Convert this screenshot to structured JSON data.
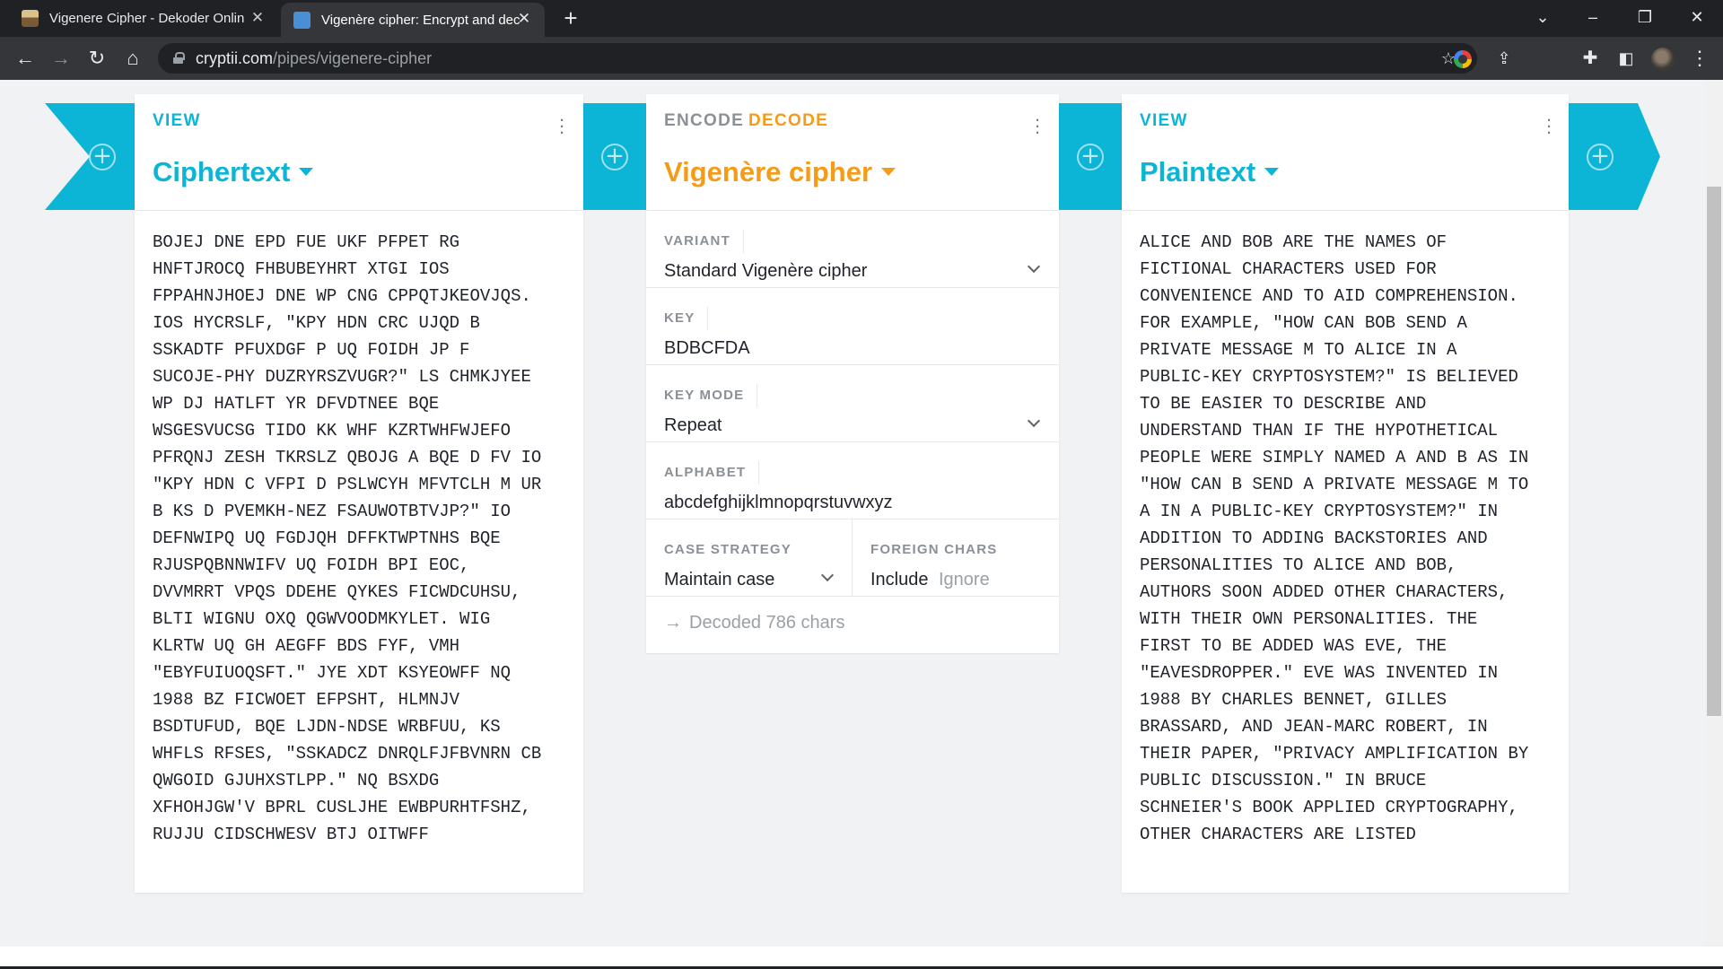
{
  "browser": {
    "tabs": [
      {
        "title": "Vigenere Cipher - Dekoder Onlin"
      },
      {
        "title": "Vigenère cipher: Encrypt and dec"
      }
    ],
    "url_host": "cryptii.com",
    "url_path": "/pipes/vigenere-cipher"
  },
  "colors": {
    "accent_teal": "#0cb5d6",
    "accent_orange": "#f49c17"
  },
  "pipeline": {
    "input": {
      "label": "VIEW",
      "title": "Ciphertext",
      "text": "BOJEJ DNE EPD FUE UKF PFPET RG\nHNFTJROCQ FHBUBEYHRT XTGI IOS\nFPPAHNJHOEJ DNE WP CNG CPPQTJKEOVJQS.\nIOS HYCRSLF, \"KPY HDN CRC UJQD B\nSSKADTF PFUXDGF P UQ FOIDH JP F\nSUCOJE-PHY DUZRYRSZVUGR?\" LS CHMKJYEE\nWP DJ HATLFT YR DFVDTNEE BQE\nWSGESVUCSG TIDO KK WHF KZRTWHFWJEFO\nPFRQNJ ZESH TKRSLZ QBOJG A BQE D FV IO\n\"KPY HDN C VFPI D PSLWCYH MFVTCLH M UR\nB KS D PVEMKH-NEZ FSAUWOTBTVJP?\" IO\nDEFNWIPQ UQ FGDJQH DFFKTWPTNHS BQE\nRJUSPQBNNWIFV UQ FOIDH BPI EOC,\nDVVMRRT VPQS DDEHE QYKES FICWDCUHSU,\nBLTI WIGNU OXQ QGWVOODMKYLET. WIG\nKLRTW UQ GH AEGFF BDS FYF, VMH\n\"EBYFUIUOQSFT.\" JYE XDT KSYEOWFF NQ\n1988 BZ FICWOET EFPSHT, HLMNJV\nBSDTUFUD, BQE LJDN-NDSE WRBFUU, KS\nWHFLS RFSES, \"SSKADCZ DNRQLFJFBVNRN CB\nQWGOID GJUHXSTLPP.\" NQ BSXDG\nXFHOHJGW'V BPRL CUSLJHE EWBPURHTFSHZ,\nRUJJU CIDSCHWESV BTJ OITWFF"
    },
    "encoder": {
      "modes": [
        "ENCODE",
        "DECODE"
      ],
      "active_mode": "DECODE",
      "title": "Vigenère cipher",
      "variant": {
        "label": "VARIANT",
        "value": "Standard Vigenère cipher"
      },
      "key": {
        "label": "KEY",
        "value": "BDBCFDA"
      },
      "key_mode": {
        "label": "KEY MODE",
        "value": "Repeat"
      },
      "alphabet": {
        "label": "ALPHABET",
        "value": "abcdefghijklmnopqrstuvwxyz"
      },
      "case_strategy": {
        "label": "CASE STRATEGY",
        "value": "Maintain case"
      },
      "foreign_chars": {
        "label": "FOREIGN CHARS",
        "options": [
          "Include",
          "Ignore"
        ],
        "selected": "Include"
      },
      "status": "Decoded 786 chars"
    },
    "output": {
      "label": "VIEW",
      "title": "Plaintext",
      "text": "ALICE AND BOB ARE THE NAMES OF\nFICTIONAL CHARACTERS USED FOR\nCONVENIENCE AND TO AID COMPREHENSION.\nFOR EXAMPLE, \"HOW CAN BOB SEND A\nPRIVATE MESSAGE M TO ALICE IN A\nPUBLIC-KEY CRYPTOSYSTEM?\" IS BELIEVED\nTO BE EASIER TO DESCRIBE AND\nUNDERSTAND THAN IF THE HYPOTHETICAL\nPEOPLE WERE SIMPLY NAMED A AND B AS IN\n\"HOW CAN B SEND A PRIVATE MESSAGE M TO\nA IN A PUBLIC-KEY CRYPTOSYSTEM?\" IN\nADDITION TO ADDING BACKSTORIES AND\nPERSONALITIES TO ALICE AND BOB,\nAUTHORS SOON ADDED OTHER CHARACTERS,\nWITH THEIR OWN PERSONALITIES. THE\nFIRST TO BE ADDED WAS EVE, THE\n\"EAVESDROPPER.\" EVE WAS INVENTED IN\n1988 BY CHARLES BENNET, GILLES\nBRASSARD, AND JEAN-MARC ROBERT, IN\nTHEIR PAPER, \"PRIVACY AMPLIFICATION BY\nPUBLIC DISCUSSION.\" IN BRUCE\nSCHNEIER'S BOOK APPLIED CRYPTOGRAPHY,\nOTHER CHARACTERS ARE LISTED"
    }
  }
}
